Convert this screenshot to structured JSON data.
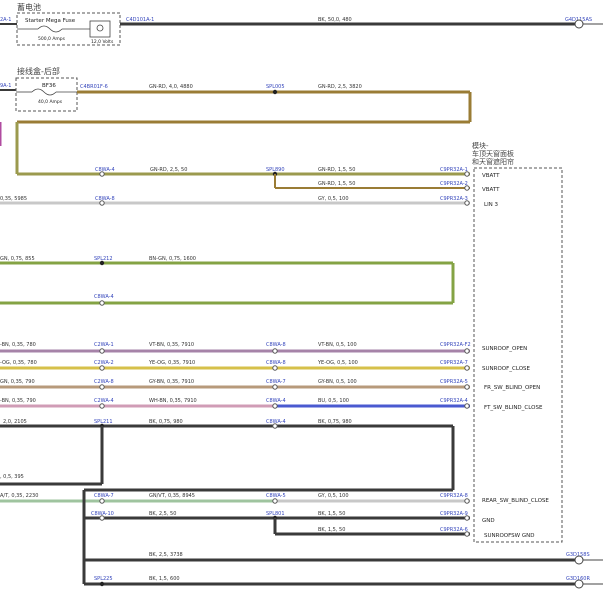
{
  "top": {
    "cn_label": "蓄电池",
    "left_conn": "2A-1",
    "fuse_box_label": "Starter Mega Fuse",
    "fuse_rating": "500,0 Amps",
    "battery_label": "12,0 Volts",
    "conn_right": "C4D101A-1",
    "wire": "BK, 50,0, 480",
    "ground": "G4D115AS"
  },
  "fuse2": {
    "cn_label": "接线盒-后部",
    "left_conn": "9A-1",
    "fuse_name": "BF36",
    "fuse_rating": "40,0 Amps",
    "conn_right": "C4BR01F-6",
    "wire1": "GN-RD, 4,0, 4880",
    "splice": "SPL005",
    "wire2": "GN-RD, 2,5, 3820"
  },
  "module": {
    "cn_label_1": "模块-",
    "cn_label_2": "车顶天窗面板",
    "cn_label_3": "和天窗遮阳帘",
    "pins": [
      "VBATT",
      "VBATT",
      "LIN 3",
      "SUNROOF_OPEN",
      "SUNROOF_CLOSE",
      "FR_SW_BLIND_OPEN",
      "FT_SW_BLIND_CLOSE",
      "REAR_SW_BLIND_CLOSE",
      "GND",
      "SUNROOFSW GND"
    ]
  },
  "rows": {
    "r1": {
      "conn1": "C8WA-4",
      "wire1": "GN-RD, 2,5, 50",
      "splice": "SPL890",
      "wire2": "GN-RD, 1,5, 50",
      "conn2": "C9PR32A-1"
    },
    "r2": {
      "wire": "GN-RD, 1,5, 50",
      "conn": "C9PR32A-2"
    },
    "r3": {
      "wire_left": "0,35, 5985",
      "conn1": "C8WA-8",
      "wire": "GY, 0,5, 100",
      "conn2": "C9PR32A-3"
    },
    "r4": {
      "wire_left": "GN, 0,75, 855",
      "splice": "SPL212",
      "wire": "BN-GN, 0,75, 1600"
    },
    "r5": {
      "conn": "C8WA-4"
    },
    "r6": {
      "wire_left": "-BN, 0,35, 780",
      "conn1": "C2WA-1",
      "wire1": "VT-BN, 0,35, 7910",
      "conn2": "C8WA-8",
      "wire2": "VT-BN, 0,5, 100",
      "conn3": "C9PR32A-F2"
    },
    "r7": {
      "wire_left": "-OG, 0,35, 780",
      "conn1": "C2WA-2",
      "wire1": "YE-OG, 0,35, 7910",
      "conn2": "C8WA-8",
      "wire2": "YE-OG, 0,5, 100",
      "conn3": "C9PR32A-7"
    },
    "r8": {
      "wire_left": "GN, 0,35, 790",
      "conn1": "C2WA-8",
      "wire1": "GY-BN, 0,35, 7910",
      "conn2": "C8WA-7",
      "wire2": "GY-BN, 0,5, 100",
      "conn3": "C9PR32A-5"
    },
    "r9": {
      "wire_left": "-BN, 0,35, 790",
      "conn1": "C2WA-4",
      "wire1": "WH-BN, 0,35, 7910",
      "conn2": "C8WA-4",
      "wire2": "BU, 0,5, 100",
      "conn3": "C9PR32A-4"
    },
    "r10": {
      "wire_left": "2,0, 2105",
      "splice": "SPL211",
      "wire1": "BK, 0,75, 980",
      "conn": "C8WA-4",
      "wire2": "BK, 0,75, 980"
    },
    "r11": {
      "wire_left": ", 0,5, 395"
    },
    "r12": {
      "wire_left": "A/T, 0,35, 2230",
      "conn1": "C8WA-7",
      "wire1": "GN/VT, 0,35, 8945",
      "conn2": "C8WA-5",
      "wire2": "GY, 0,5, 100",
      "conn3": "C9PR32A-8"
    },
    "r13": {
      "conn1": "C8WA-10",
      "wire1": "BK, 2,5, 50",
      "splice": "SPL801",
      "wire2": "BK, 1,5, 50",
      "conn2": "C9PR32A-9"
    },
    "r14": {
      "wire": "BK, 1,5, 50",
      "conn": "C9PR32A-6"
    },
    "r15": {
      "wire": "BK, 2,5, 3738",
      "ground": "G3D158S"
    },
    "r16": {
      "splice": "SPL225",
      "wire": "BK, 1,5, 600",
      "ground": "G3D160R"
    }
  },
  "colors": {
    "black": "#3a3a3a",
    "olive": "#9b9a4e",
    "brown": "#9a7c35",
    "green": "#84a344",
    "grey": "#c8c8c8",
    "violet": "#a683a8",
    "yellow": "#d6c04a",
    "tan": "#b79a7b",
    "pink": "#d09cb6",
    "blue": "#4a5ad0",
    "greenish": "#9fc49f",
    "magenta": "#b04ca0"
  }
}
